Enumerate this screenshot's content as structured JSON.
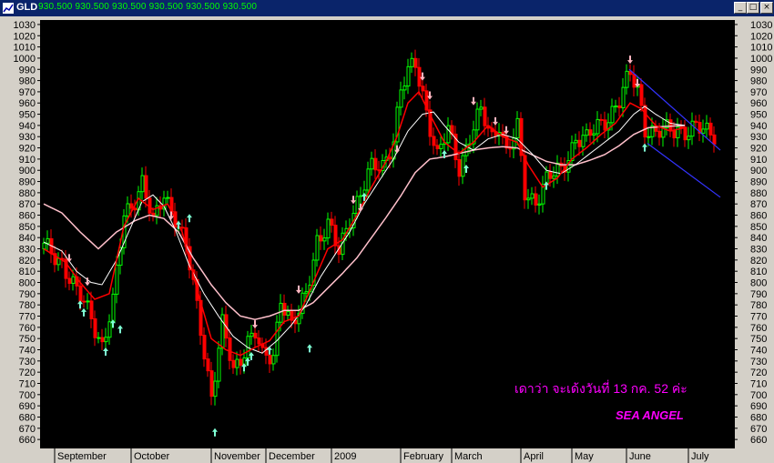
{
  "window": {
    "symbol": "GLD",
    "values_text": "930.500 930.500 930.500 930.500 930.500 930.500"
  },
  "colors": {
    "background": "#000000",
    "up_bar": "#00ff00",
    "down_bar": "#ff0000",
    "ma_fast": "#ff0000",
    "ma_mid": "#ffffff",
    "ma_slow": "#ffc0cb",
    "channel": "#3333ff",
    "buy_arrow": "#7fffd4",
    "sell_arrow": "#ffb6c1",
    "annotation": "#ff00ff"
  },
  "chart_data": {
    "type": "candlestick",
    "y_ticks": [
      660,
      670,
      680,
      690,
      700,
      710,
      720,
      730,
      740,
      750,
      760,
      770,
      780,
      790,
      800,
      810,
      820,
      830,
      840,
      850,
      860,
      870,
      880,
      890,
      900,
      910,
      920,
      930,
      940,
      950,
      960,
      970,
      980,
      990,
      1000,
      1010,
      1020,
      1030
    ],
    "ylim": [
      652,
      1034
    ],
    "x_labels": [
      "September",
      "October",
      "November",
      "December",
      "2009",
      "February",
      "March",
      "April",
      "May",
      "June",
      "July"
    ],
    "x_label_bars": [
      4,
      25,
      47,
      62,
      80,
      99,
      113,
      132,
      146,
      161,
      178
    ],
    "n_bars": 185,
    "anchors": [
      [
        0,
        830
      ],
      [
        5,
        820
      ],
      [
        9,
        790
      ],
      [
        13,
        770
      ],
      [
        16,
        745
      ],
      [
        19,
        780
      ],
      [
        22,
        860
      ],
      [
        24,
        870
      ],
      [
        27,
        890
      ],
      [
        30,
        850
      ],
      [
        33,
        880
      ],
      [
        36,
        860
      ],
      [
        39,
        830
      ],
      [
        43,
        760
      ],
      [
        46,
        700
      ],
      [
        49,
        760
      ],
      [
        52,
        720
      ],
      [
        56,
        750
      ],
      [
        58,
        755
      ],
      [
        60,
        730
      ],
      [
        63,
        735
      ],
      [
        65,
        790
      ],
      [
        68,
        760
      ],
      [
        70,
        770
      ],
      [
        72,
        790
      ],
      [
        75,
        840
      ],
      [
        78,
        850
      ],
      [
        81,
        825
      ],
      [
        84,
        860
      ],
      [
        87,
        880
      ],
      [
        90,
        900
      ],
      [
        93,
        905
      ],
      [
        96,
        930
      ],
      [
        98,
        970
      ],
      [
        100,
        985
      ],
      [
        102,
        995
      ],
      [
        104,
        970
      ],
      [
        106,
        940
      ],
      [
        108,
        910
      ],
      [
        111,
        935
      ],
      [
        114,
        905
      ],
      [
        117,
        930
      ],
      [
        120,
        950
      ],
      [
        123,
        930
      ],
      [
        125,
        945
      ],
      [
        127,
        915
      ],
      [
        130,
        935
      ],
      [
        132,
        880
      ],
      [
        135,
        875
      ],
      [
        138,
        890
      ],
      [
        142,
        900
      ],
      [
        146,
        930
      ],
      [
        149,
        925
      ],
      [
        152,
        940
      ],
      [
        155,
        950
      ],
      [
        158,
        960
      ],
      [
        161,
        985
      ],
      [
        163,
        975
      ],
      [
        165,
        940
      ],
      [
        168,
        930
      ],
      [
        171,
        935
      ],
      [
        174,
        940
      ],
      [
        176,
        935
      ]
    ],
    "ma_fast_anchors": [
      [
        0,
        830
      ],
      [
        6,
        818
      ],
      [
        10,
        800
      ],
      [
        14,
        785
      ],
      [
        18,
        790
      ],
      [
        22,
        850
      ],
      [
        26,
        875
      ],
      [
        30,
        865
      ],
      [
        34,
        870
      ],
      [
        38,
        845
      ],
      [
        42,
        795
      ],
      [
        46,
        750
      ],
      [
        50,
        740
      ],
      [
        54,
        735
      ],
      [
        58,
        742
      ],
      [
        62,
        748
      ],
      [
        66,
        765
      ],
      [
        70,
        770
      ],
      [
        74,
        800
      ],
      [
        78,
        830
      ],
      [
        82,
        838
      ],
      [
        86,
        860
      ],
      [
        90,
        885
      ],
      [
        94,
        908
      ],
      [
        97,
        930
      ],
      [
        100,
        960
      ],
      [
        103,
        970
      ],
      [
        106,
        950
      ],
      [
        110,
        925
      ],
      [
        114,
        915
      ],
      [
        118,
        925
      ],
      [
        122,
        940
      ],
      [
        126,
        930
      ],
      [
        130,
        925
      ],
      [
        133,
        905
      ],
      [
        137,
        885
      ],
      [
        141,
        893
      ],
      [
        145,
        910
      ],
      [
        149,
        920
      ],
      [
        153,
        932
      ],
      [
        157,
        942
      ],
      [
        161,
        960
      ],
      [
        164,
        955
      ],
      [
        168,
        940
      ],
      [
        172,
        935
      ],
      [
        176,
        938
      ]
    ],
    "ma_mid_anchors": [
      [
        0,
        836
      ],
      [
        5,
        828
      ],
      [
        9,
        810
      ],
      [
        13,
        800
      ],
      [
        16,
        798
      ],
      [
        20,
        820
      ],
      [
        24,
        850
      ],
      [
        27,
        872
      ],
      [
        30,
        878
      ],
      [
        33,
        868
      ],
      [
        36,
        848
      ],
      [
        40,
        815
      ],
      [
        44,
        790
      ],
      [
        48,
        770
      ],
      [
        52,
        752
      ],
      [
        56,
        742
      ],
      [
        60,
        737
      ],
      [
        64,
        748
      ],
      [
        68,
        762
      ],
      [
        72,
        780
      ],
      [
        76,
        805
      ],
      [
        80,
        825
      ],
      [
        84,
        845
      ],
      [
        88,
        870
      ],
      [
        92,
        890
      ],
      [
        96,
        910
      ],
      [
        100,
        935
      ],
      [
        104,
        950
      ],
      [
        107,
        952
      ],
      [
        110,
        940
      ],
      [
        114,
        925
      ],
      [
        118,
        918
      ],
      [
        122,
        928
      ],
      [
        126,
        932
      ],
      [
        130,
        928
      ],
      [
        134,
        915
      ],
      [
        138,
        900
      ],
      [
        142,
        897
      ],
      [
        146,
        905
      ],
      [
        150,
        915
      ],
      [
        154,
        925
      ],
      [
        158,
        935
      ],
      [
        162,
        950
      ],
      [
        165,
        957
      ],
      [
        168,
        950
      ],
      [
        172,
        942
      ],
      [
        176,
        940
      ]
    ],
    "ma_slow_anchors": [
      [
        0,
        870
      ],
      [
        5,
        862
      ],
      [
        10,
        845
      ],
      [
        15,
        830
      ],
      [
        20,
        845
      ],
      [
        25,
        855
      ],
      [
        29,
        860
      ],
      [
        33,
        857
      ],
      [
        37,
        845
      ],
      [
        41,
        822
      ],
      [
        46,
        798
      ],
      [
        50,
        782
      ],
      [
        54,
        770
      ],
      [
        58,
        767
      ],
      [
        62,
        770
      ],
      [
        66,
        775
      ],
      [
        70,
        775
      ],
      [
        74,
        782
      ],
      [
        78,
        795
      ],
      [
        82,
        808
      ],
      [
        86,
        822
      ],
      [
        90,
        840
      ],
      [
        94,
        858
      ],
      [
        98,
        877
      ],
      [
        102,
        898
      ],
      [
        106,
        910
      ],
      [
        110,
        912
      ],
      [
        114,
        915
      ],
      [
        118,
        918
      ],
      [
        122,
        920
      ],
      [
        126,
        921
      ],
      [
        130,
        920
      ],
      [
        134,
        914
      ],
      [
        138,
        908
      ],
      [
        142,
        905
      ],
      [
        146,
        905
      ],
      [
        150,
        909
      ],
      [
        154,
        914
      ],
      [
        158,
        922
      ],
      [
        162,
        932
      ],
      [
        166,
        938
      ],
      [
        170,
        939
      ],
      [
        176,
        940
      ]
    ],
    "channel_upper": [
      [
        161,
        990
      ],
      [
        186,
        918
      ]
    ],
    "channel_lower": [
      [
        166,
        924
      ],
      [
        186,
        876
      ]
    ],
    "up_arrows": [
      [
        10,
        784
      ],
      [
        11,
        777
      ],
      [
        17,
        742
      ],
      [
        19,
        767
      ],
      [
        21,
        762
      ],
      [
        37,
        855
      ],
      [
        40,
        861
      ],
      [
        47,
        670
      ],
      [
        55,
        728
      ],
      [
        56,
        733
      ],
      [
        57,
        738
      ],
      [
        62,
        743
      ],
      [
        73,
        745
      ],
      [
        88,
        880
      ],
      [
        110,
        918
      ],
      [
        116,
        905
      ],
      [
        138,
        890
      ],
      [
        165,
        924
      ]
    ],
    "down_arrows": [
      [
        7,
        818
      ],
      [
        12,
        797
      ],
      [
        35,
        856
      ],
      [
        58,
        759
      ],
      [
        70,
        790
      ],
      [
        85,
        870
      ],
      [
        87,
        863
      ],
      [
        97,
        915
      ],
      [
        104,
        980
      ],
      [
        106,
        963
      ],
      [
        118,
        958
      ],
      [
        124,
        940
      ],
      [
        127,
        932
      ],
      [
        161,
        995
      ],
      [
        163,
        974
      ]
    ],
    "annotation_thai": "เดาว่า จะเด้งวันที่ 13 กค. 52 ค่ะ",
    "annotation_sig": "SEA ANGEL",
    "annotation_pos": [
      [
        565,
        432
      ],
      [
        676,
        461
      ]
    ]
  }
}
